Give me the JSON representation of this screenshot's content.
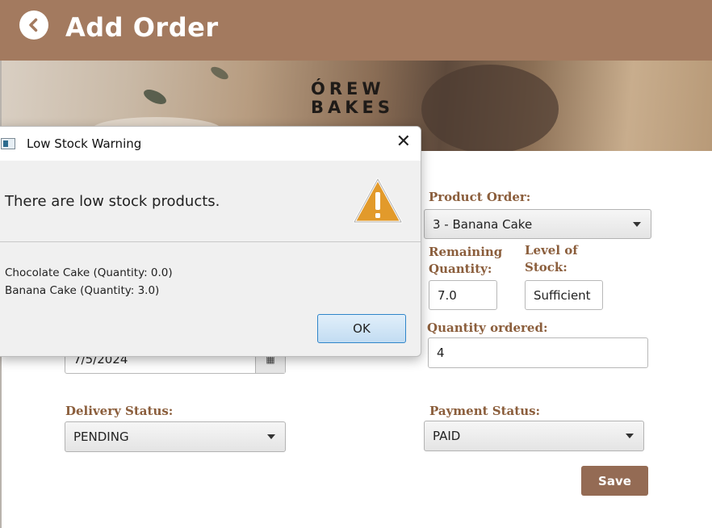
{
  "header": {
    "title": "Add Order"
  },
  "banner": {
    "logo_line1": "ÓREW",
    "logo_line2": "BAKES"
  },
  "form": {
    "date_value": "7/5/2024",
    "product_order_label": "Product Order:",
    "product_order_value": "3 - Banana Cake",
    "remaining_qty_label_1": "Remaining",
    "remaining_qty_label_2": "Quantity:",
    "remaining_qty_value": "7.0",
    "stock_level_label_1": "Level of",
    "stock_level_label_2": "Stock:",
    "stock_level_value": "Sufficient",
    "qty_ordered_label": "Quantity ordered:",
    "qty_ordered_value": "4",
    "delivery_status_label": "Delivery Status:",
    "delivery_status_value": "PENDING",
    "payment_status_label": "Payment Status:",
    "payment_status_value": "PAID",
    "save_label": "Save"
  },
  "dialog": {
    "title": "Low Stock Warning",
    "message": "There are low stock products.",
    "details": [
      "Chocolate Cake (Quantity: 0.0)",
      "Banana Cake (Quantity: 3.0)"
    ],
    "ok_label": "OK",
    "close_glyph": "✕"
  },
  "colors": {
    "header": "#a37a5f",
    "label": "#8b5e3c",
    "save": "#946b54",
    "warning": "#e29a2b"
  }
}
